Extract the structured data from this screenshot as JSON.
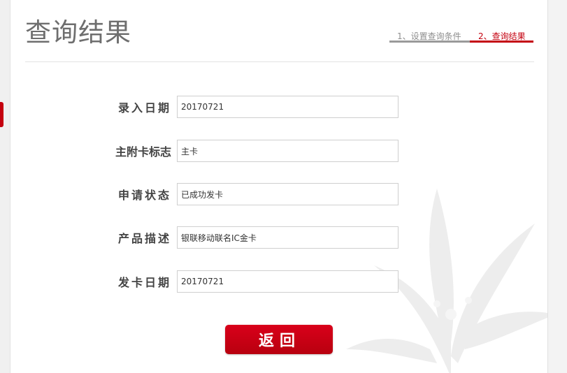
{
  "page": {
    "title": "查询结果",
    "steps": [
      {
        "label": "1、设置查询条件",
        "active": false
      },
      {
        "label": "2、查询结果",
        "active": true
      }
    ]
  },
  "form": {
    "rows": [
      {
        "label": "录入日期",
        "value": "20170721"
      },
      {
        "label": "主附卡标志",
        "value": "主卡"
      },
      {
        "label": "申请状态",
        "value": "已成功发卡"
      },
      {
        "label": "产品描述",
        "value": "银联移动联名IC金卡"
      },
      {
        "label": "发卡日期",
        "value": "20170721"
      }
    ]
  },
  "actions": {
    "back_label": "返回"
  },
  "colors": {
    "accent": "#c4000f",
    "step_inactive": "#9a9a9a",
    "title": "#6e6e6e"
  }
}
